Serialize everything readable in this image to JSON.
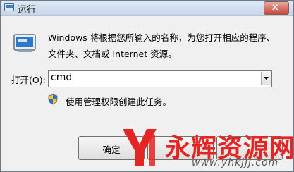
{
  "window": {
    "title": "运行",
    "close_glyph": "x"
  },
  "icons": {
    "title_icon": "run-icon",
    "main_icon": "run-icon",
    "close": "close-icon",
    "dropdown": "chevron-down-icon",
    "shield": "uac-shield-icon"
  },
  "description": {
    "line1": "Windows 将根据您所输入的名称，为您打开相应的程序、",
    "line2": "文件夹、文档或 Internet 资源。"
  },
  "open_field": {
    "label": "打开(O):",
    "value": "cmd"
  },
  "admin_note": "使用管理权限创建此任务。",
  "buttons": {
    "ok": "确定"
  },
  "watermark": {
    "text": "永辉资源网",
    "url": "www.yhkjjj.com",
    "color": "#e52424"
  }
}
